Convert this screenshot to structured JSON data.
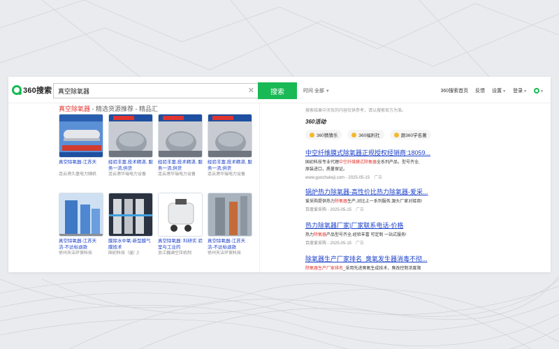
{
  "header": {
    "logo_text": "360搜索",
    "search_value": "真空除氧器",
    "search_button": "搜索",
    "time_filter": "时间 全部",
    "nav": [
      "360搜索首页",
      "反馈",
      "设置",
      "登录"
    ]
  },
  "shop_panel": {
    "title_hl": "真空除氧器",
    "title_rest": " - 精选货源推荐 - 精品汇",
    "products": [
      {
        "title": "真空除氧器-江苏天",
        "seller": "连云港久盛电力辅机"
      },
      {
        "title": "经验丰富,技术精湛, 服务一流,供货",
        "seller": "连云港华瑞电力设备"
      },
      {
        "title": "经验丰富,技术精湛, 服务一流,供货",
        "seller": "连云港华瑞电力设备"
      },
      {
        "title": "经验丰富,技术精湛, 服务一流,供货",
        "seller": "连云港华瑞电力设备"
      },
      {
        "title": "真空除氧器-江苏天 洁-不达标退款",
        "seller": "徐州天洁环保科技"
      },
      {
        "title": "膜除水中氧-新型膜气 膜技术",
        "seller": "国初科技（厦门）"
      },
      {
        "title": "真空除氧器: 科研实 验室与工业的",
        "seller": "浙江巍澜空压机制"
      },
      {
        "title": "真空除氧器-江苏天 洁-不达标退款",
        "seller": "徐州天洁环保科技"
      }
    ],
    "badge_text": "专业电力设备"
  },
  "right": {
    "note": "搜索结果中涉及的内容仅供参考，请以搜索官方为准。",
    "activity_title": "360活动",
    "activity_chips": [
      "360猜猜乐",
      "360福利社",
      "跟360学名著"
    ],
    "results": [
      {
        "title": "中空纤维膜式除氧器正规授权经销商:18059...",
        "desc_a": "国初科技专业代理",
        "desc_hl": "中空纤维膜式除氧器",
        "desc_b": "全系列产品，型号齐全,",
        "desc_c": "原装进口，质量保证。",
        "meta": "www.guochukeji.com - 2025-05-15",
        "ad": "广告"
      },
      {
        "title": "锅炉热力除氧器-高性价比热力除氧器-爱采...",
        "desc_a": "爱采购提供热力",
        "desc_hl": "除氧器",
        "desc_b": "生产,对比上一系列服务,源头厂家对接商!",
        "desc_c": "",
        "meta": "百度爱采购 - 2025-05-15",
        "ad": "广告"
      },
      {
        "title": "热力除氧器厂家|厂家联系电话-价格",
        "desc_a": "热力",
        "desc_hl": "除氧器",
        "desc_b": "产品型号齐全,经验丰富 可定制 一站式服务!",
        "desc_c": "",
        "meta": "百度爱采购 - 2025-05-15",
        "ad": "广告"
      },
      {
        "title": "除氧器生产厂家排名_臭氧发生器消毒不彻...",
        "desc_a": "",
        "desc_hl": "除氧器生产厂家排名",
        "desc_b": "_采用先进臭氧生成技术，臭改控制浓度限",
        "desc_c": "",
        "meta": "",
        "ad": ""
      }
    ]
  },
  "colors": {
    "brand_green": "#19b955",
    "link_blue": "#1a3fc9",
    "highlight_red": "#e0342f"
  }
}
